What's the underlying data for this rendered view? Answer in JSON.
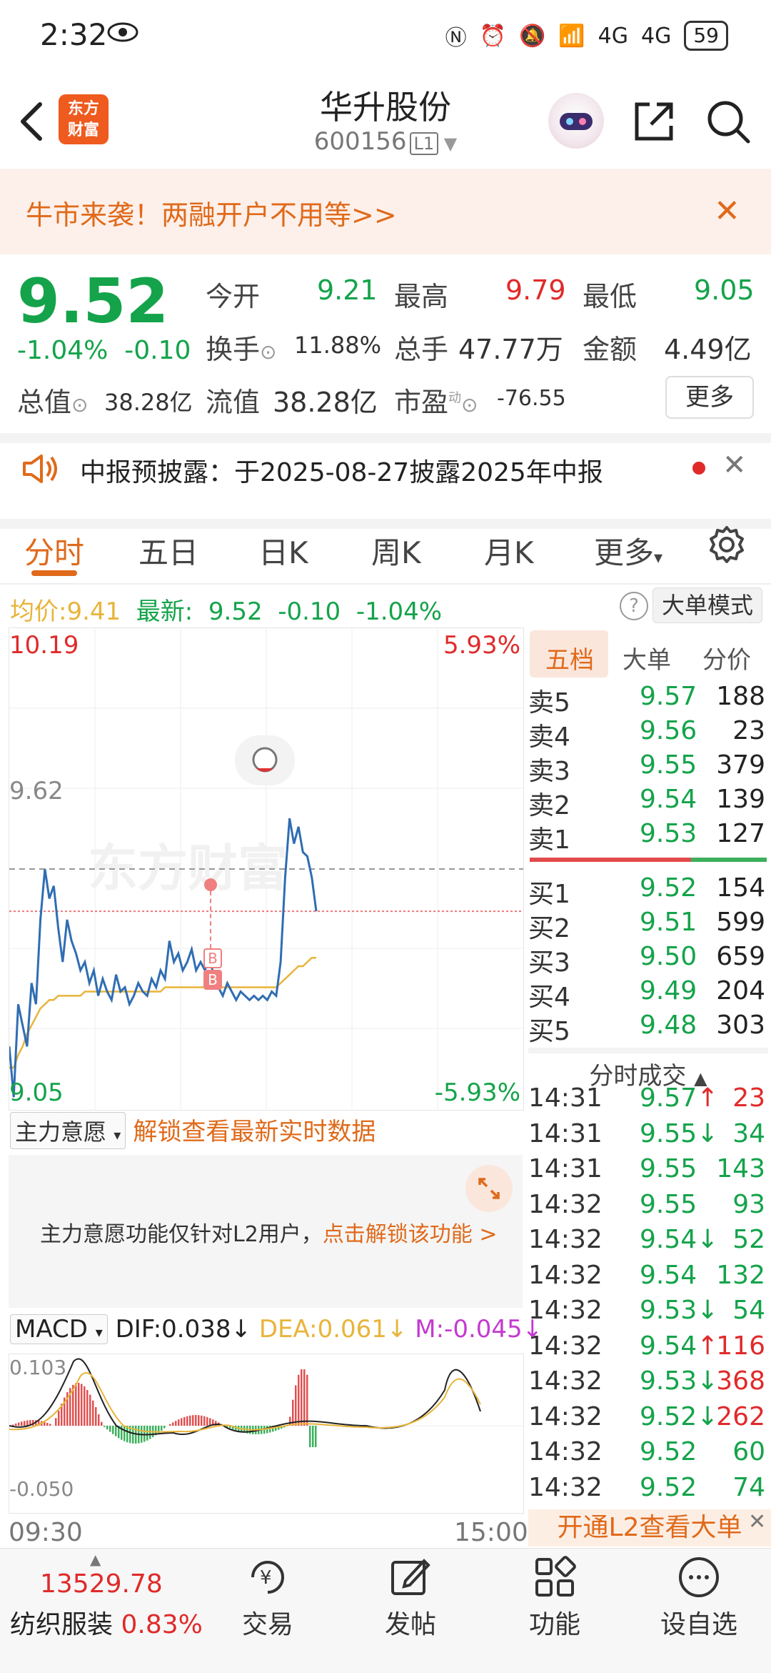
{
  "status_bar": {
    "time": "2:32",
    "network_1": "4G",
    "network_2": "4G",
    "battery": "59"
  },
  "header": {
    "stock_name": "华升股份",
    "stock_code": "600156",
    "level_badge": "L1",
    "logo_text": "东方财富"
  },
  "banner": {
    "text": "牛市来袭！两融开户不用等>>"
  },
  "quote": {
    "price": "9.52",
    "pct": "-1.04%",
    "change": "-0.10",
    "open_label": "今开",
    "open": "9.21",
    "high_label": "最高",
    "high": "9.79",
    "low_label": "最低",
    "low": "9.05",
    "turnover_label": "换手",
    "turnover": "11.88%",
    "volume_label": "总手",
    "volume": "47.77万",
    "amount_label": "金额",
    "amount": "4.49亿",
    "mktcap_label": "总值",
    "mktcap": "38.28亿",
    "float_label": "流值",
    "float_cap": "38.28亿",
    "pe_label": "市盈",
    "pe_sup": "动",
    "pe": "-76.55",
    "more_label": "更多"
  },
  "notice": {
    "text": "中报预披露：于2025-08-27披露2025年中报"
  },
  "tabs": [
    "分时",
    "五日",
    "日K",
    "周K",
    "月K",
    "更多"
  ],
  "avg_row": {
    "avg_label": "均价:",
    "avg": "9.41",
    "latest_label": "最新:",
    "latest": "9.52",
    "change": "-0.10",
    "pct": "-1.04%",
    "mode_button": "大单模式"
  },
  "chart_labels": {
    "top_left": "10.19",
    "top_right": "5.93%",
    "mid_left": "9.62",
    "bottom_left": "9.05",
    "bottom_right": "-5.93%",
    "marker_b1": "B",
    "marker_b2": "B",
    "watermark": "东方财富"
  },
  "chart_data": {
    "type": "line",
    "ylim": [
      9.05,
      10.19
    ],
    "reference_price": 9.62,
    "series": [
      {
        "values": [
          9.2,
          9.08,
          9.3,
          9.25,
          9.2,
          9.35,
          9.3,
          9.5,
          9.62,
          9.55,
          9.58,
          9.48,
          9.4,
          9.5,
          9.45,
          9.42,
          9.38,
          9.4,
          9.35,
          9.38,
          9.32,
          9.36,
          9.33,
          9.31,
          9.37,
          9.33,
          9.34,
          9.3,
          9.32,
          9.35,
          9.33,
          9.32,
          9.36,
          9.34,
          9.38,
          9.36,
          9.45,
          9.4,
          9.42,
          9.38,
          9.4,
          9.43,
          9.38,
          9.4,
          9.38,
          9.42,
          9.36,
          9.34,
          9.32,
          9.35,
          9.33,
          9.31,
          9.33,
          9.32,
          9.31,
          9.32,
          9.31,
          9.32,
          9.31,
          9.33,
          9.32,
          9.4,
          9.6,
          9.74,
          9.68,
          9.72,
          9.66,
          9.65,
          9.6,
          9.52
        ]
      },
      {
        "values": [
          9.15,
          9.15,
          9.18,
          9.2,
          9.23,
          9.25,
          9.27,
          9.29,
          9.3,
          9.31,
          9.31,
          9.32,
          9.32,
          9.32,
          9.32,
          9.32,
          9.32,
          9.33,
          9.33,
          9.33,
          9.33,
          9.33,
          9.33,
          9.33,
          9.33,
          9.33,
          9.33,
          9.33,
          9.33,
          9.33,
          9.33,
          9.33,
          9.33,
          9.33,
          9.33,
          9.34,
          9.34,
          9.34,
          9.34,
          9.34,
          9.34,
          9.34,
          9.34,
          9.34,
          9.34,
          9.34,
          9.34,
          9.34,
          9.34,
          9.34,
          9.34,
          9.34,
          9.34,
          9.34,
          9.34,
          9.34,
          9.34,
          9.34,
          9.34,
          9.34,
          9.34,
          9.35,
          9.36,
          9.37,
          9.38,
          9.39,
          9.39,
          9.4,
          9.41,
          9.41
        ]
      }
    ],
    "x_labels": [
      "09:30",
      "15:00"
    ]
  },
  "orderbook": {
    "tabs": [
      "五档",
      "大单",
      "分价"
    ],
    "sell": [
      {
        "name": "卖5",
        "price": "9.57",
        "vol": "188"
      },
      {
        "name": "卖4",
        "price": "9.56",
        "vol": "23"
      },
      {
        "name": "卖3",
        "price": "9.55",
        "vol": "379"
      },
      {
        "name": "卖2",
        "price": "9.54",
        "vol": "139"
      },
      {
        "name": "卖1",
        "price": "9.53",
        "vol": "127"
      }
    ],
    "buy": [
      {
        "name": "买1",
        "price": "9.52",
        "vol": "154"
      },
      {
        "name": "买2",
        "price": "9.51",
        "vol": "599"
      },
      {
        "name": "买3",
        "price": "9.50",
        "vol": "659"
      },
      {
        "name": "买4",
        "price": "9.49",
        "vol": "204"
      },
      {
        "name": "买5",
        "price": "9.48",
        "vol": "303"
      }
    ]
  },
  "trades": {
    "header": "分时成交",
    "rows": [
      {
        "time": "14:31",
        "price": "9.57",
        "dir": "↑",
        "vol": "23",
        "color": "red"
      },
      {
        "time": "14:31",
        "price": "9.55",
        "dir": "↓",
        "vol": "34",
        "color": "green"
      },
      {
        "time": "14:31",
        "price": "9.55",
        "dir": "",
        "vol": "143",
        "color": "green"
      },
      {
        "time": "14:32",
        "price": "9.55",
        "dir": "",
        "vol": "93",
        "color": "green"
      },
      {
        "time": "14:32",
        "price": "9.54",
        "dir": "↓",
        "vol": "52",
        "color": "green"
      },
      {
        "time": "14:32",
        "price": "9.54",
        "dir": "",
        "vol": "132",
        "color": "green"
      },
      {
        "time": "14:32",
        "price": "9.53",
        "dir": "↓",
        "vol": "54",
        "color": "green"
      },
      {
        "time": "14:32",
        "price": "9.54",
        "dir": "↑",
        "vol": "116",
        "color": "red"
      },
      {
        "time": "14:32",
        "price": "9.53",
        "dir": "↓",
        "vol": "368",
        "color": "red"
      },
      {
        "time": "14:32",
        "price": "9.52",
        "dir": "↓",
        "vol": "262",
        "color": "red"
      },
      {
        "time": "14:32",
        "price": "9.52",
        "dir": "",
        "vol": "60",
        "color": "green"
      },
      {
        "time": "14:32",
        "price": "9.52",
        "dir": "",
        "vol": "74",
        "color": "green"
      }
    ],
    "l2_cta": "开通L2查看大单"
  },
  "intent": {
    "dropdown": "主力意愿",
    "unlock_text": "解锁查看最新实时数据",
    "panel_text": "主力意愿功能仅针对L2用户，",
    "panel_link": "点击解锁该功能 >"
  },
  "macd": {
    "dropdown": "MACD",
    "dif": "DIF:0.038",
    "dea": "DEA:0.061",
    "m": "M:-0.045",
    "ymax": "0.103",
    "ymin": "-0.050"
  },
  "bottom_nav": {
    "index_value": "13529.78",
    "index_name": "纺织服装",
    "index_pct": "0.83%",
    "items": [
      "交易",
      "发帖",
      "功能",
      "设自选"
    ]
  },
  "colors": {
    "up": "#e02a2a",
    "down": "#14a34a",
    "accent": "#e06a1a",
    "avg_line": "#e8b43a",
    "price_line": "#2f6db3"
  }
}
